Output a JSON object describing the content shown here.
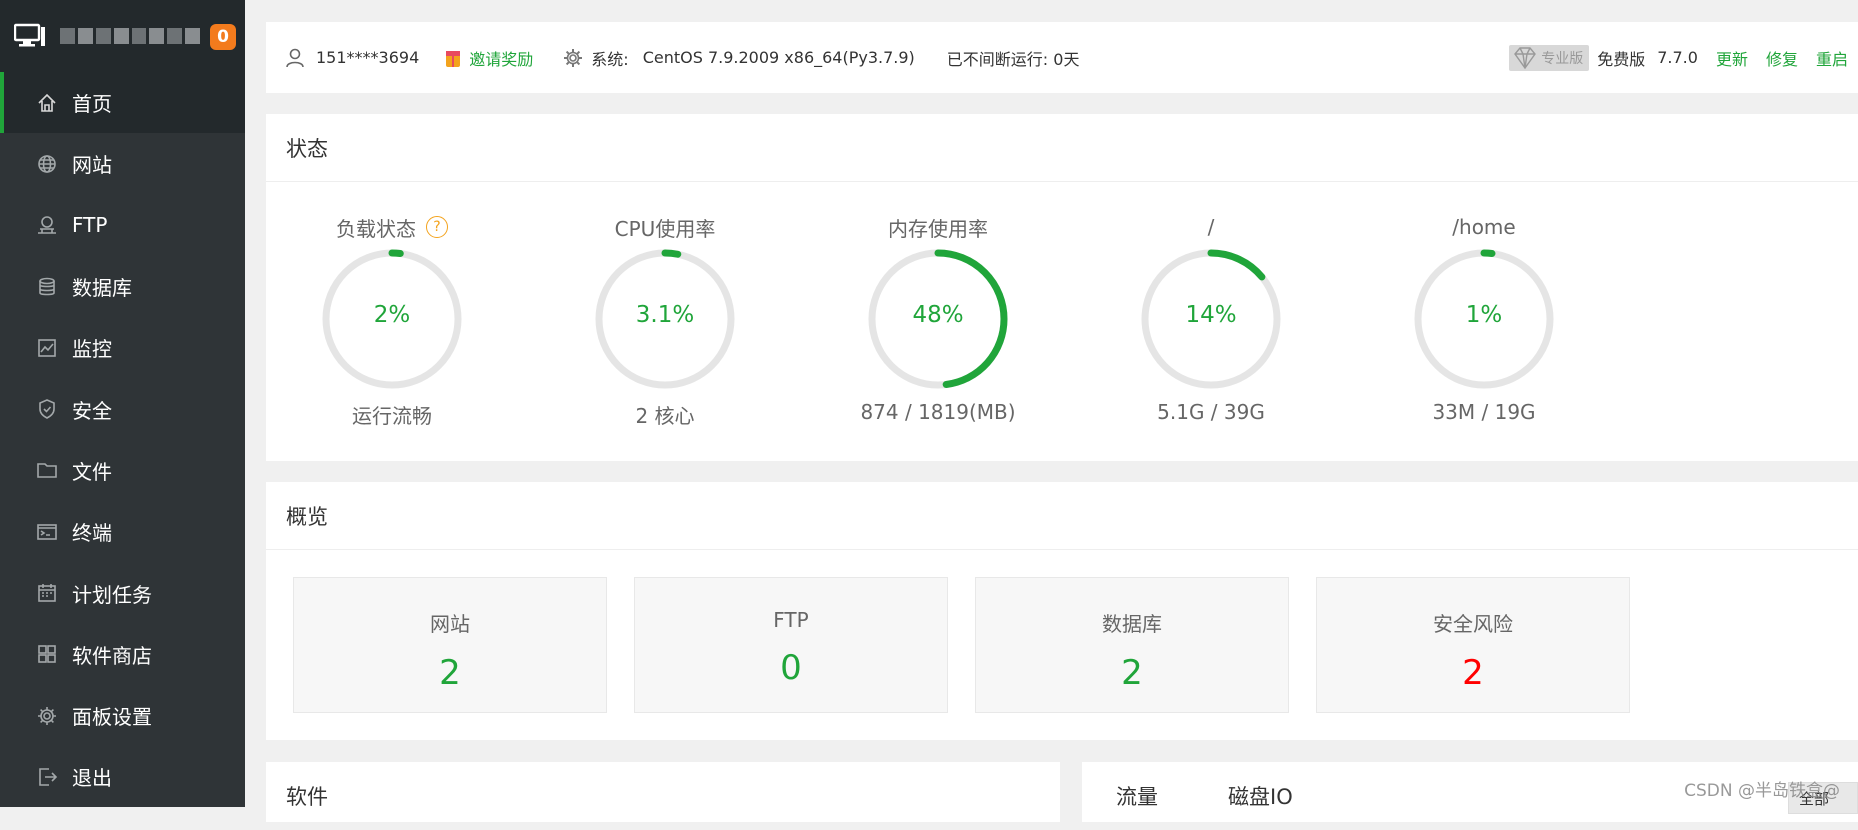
{
  "sidebar": {
    "notification_count": "0",
    "items": [
      {
        "label": "首页",
        "icon": "home-icon",
        "active": true
      },
      {
        "label": "网站",
        "icon": "globe-icon"
      },
      {
        "label": "FTP",
        "icon": "ftp-icon"
      },
      {
        "label": "数据库",
        "icon": "database-icon"
      },
      {
        "label": "监控",
        "icon": "monitor-chart-icon"
      },
      {
        "label": "安全",
        "icon": "shield-icon"
      },
      {
        "label": "文件",
        "icon": "folder-icon"
      },
      {
        "label": "终端",
        "icon": "terminal-icon"
      },
      {
        "label": "计划任务",
        "icon": "calendar-icon"
      },
      {
        "label": "软件商店",
        "icon": "grid-icon"
      },
      {
        "label": "面板设置",
        "icon": "gear-icon"
      },
      {
        "label": "退出",
        "icon": "logout-icon"
      }
    ]
  },
  "topbar": {
    "phone": "151****3694",
    "invite": "邀请奖励",
    "system_label": "系统:",
    "system_value": "CentOS 7.9.2009 x86_64(Py3.7.9)",
    "uptime": "已不间断运行: 0天",
    "pro_label": "专业版",
    "free_label": "免费版",
    "version": "7.7.0",
    "update": "更新",
    "repair": "修复",
    "restart": "重启"
  },
  "status": {
    "title": "状态",
    "gauges": [
      {
        "title": "负载状态",
        "percent": "2%",
        "value": 2,
        "sub": "运行流畅",
        "help": "?"
      },
      {
        "title": "CPU使用率",
        "percent": "3.1%",
        "value": 3.1,
        "sub": "2 核心"
      },
      {
        "title": "内存使用率",
        "percent": "48%",
        "value": 48,
        "sub": "874 / 1819(MB)"
      },
      {
        "title": "/",
        "percent": "14%",
        "value": 14,
        "sub": "5.1G / 39G"
      },
      {
        "title": "/home",
        "percent": "1%",
        "value": 1,
        "sub": "33M / 19G"
      }
    ]
  },
  "overview": {
    "title": "概览",
    "cards": [
      {
        "label": "网站",
        "value": "2"
      },
      {
        "label": "FTP",
        "value": "0"
      },
      {
        "label": "数据库",
        "value": "2"
      },
      {
        "label": "安全风险",
        "value": "2",
        "alert": true
      }
    ]
  },
  "software": {
    "title": "软件"
  },
  "traffic": {
    "tab_traffic": "流量",
    "tab_disk": "磁盘IO",
    "select_value": "全部"
  },
  "watermark": "CSDN @半岛铁盒@",
  "colors": {
    "accent": "#20a53a",
    "sidebar": "#2f3437",
    "alert": "#ff0000",
    "badge": "#f37b1d"
  }
}
